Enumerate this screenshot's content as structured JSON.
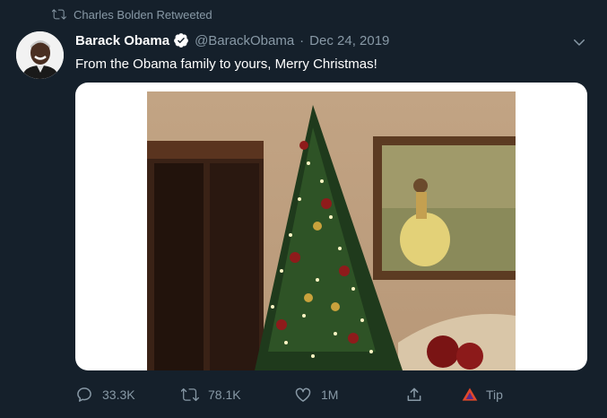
{
  "retweet": {
    "icon": "retweet-icon",
    "label": "Charles Bolden Retweeted"
  },
  "tweet": {
    "author_name": "Barack Obama",
    "verified": true,
    "handle": "@BarackObama",
    "separator": "·",
    "date": "Dec 24, 2019",
    "text": "From the Obama family to yours, Merry Christmas!",
    "media": {
      "type": "photo",
      "subject": "christmas-tree-photo"
    }
  },
  "actions": {
    "reply_count": "33.3K",
    "retweet_count": "78.1K",
    "like_count": "1M",
    "tip_label": "Tip"
  },
  "colors": {
    "background": "#15202b",
    "text_primary": "#ffffff",
    "text_secondary": "#8899a6",
    "verified_blue": "#ffffff",
    "tip_accent": "#e0482b"
  }
}
